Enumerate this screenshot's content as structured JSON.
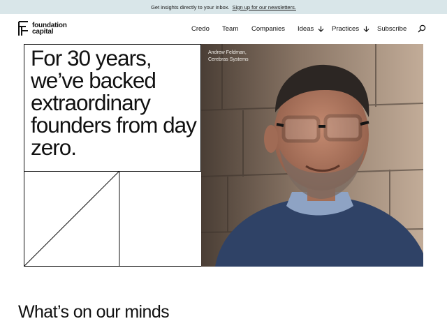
{
  "banner": {
    "text": "Get insights directly to your inbox.",
    "link": "Sign up for our newsletters."
  },
  "logo": {
    "line1": "foundation",
    "line2": "capital"
  },
  "nav": {
    "items": [
      {
        "label": "Credo",
        "has_menu": false
      },
      {
        "label": "Team",
        "has_menu": false
      },
      {
        "label": "Companies",
        "has_menu": false
      },
      {
        "label": "Ideas",
        "has_menu": true
      },
      {
        "label": "Practices",
        "has_menu": true
      },
      {
        "label": "Subscribe",
        "has_menu": false
      }
    ],
    "search_icon": "search-icon"
  },
  "hero": {
    "headline": "For 30 years, we’ve backed extraordinary founders from day zero.",
    "caption": {
      "name": "Andrew Feldman,",
      "company": "Cerebras Systems"
    }
  },
  "section": {
    "title": "What’s on our minds"
  },
  "colors": {
    "banner_bg": "#d9e6e9",
    "text": "#111111",
    "line": "#111111"
  }
}
